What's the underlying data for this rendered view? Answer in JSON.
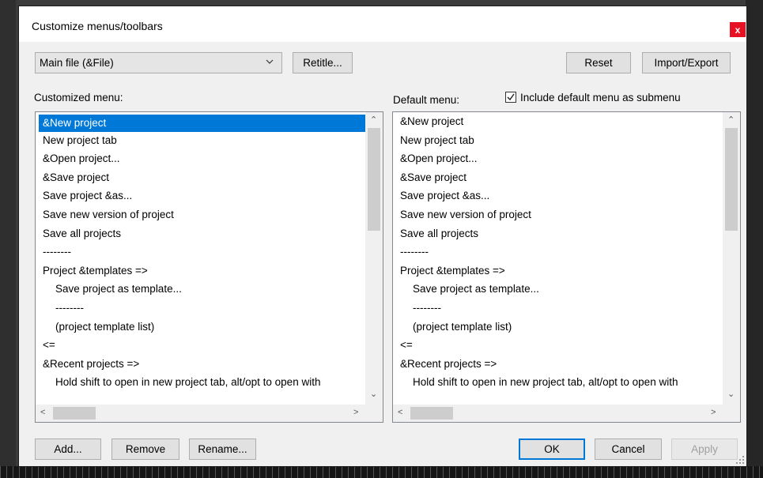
{
  "dialog": {
    "title": "Customize menus/toolbars",
    "close_label": "x"
  },
  "toolbar": {
    "menu_select_value": "Main file (&File)",
    "retitle_label": "Retitle...",
    "reset_label": "Reset",
    "import_export_label": "Import/Export"
  },
  "customized": {
    "label": "Customized menu:",
    "items": [
      "&New project",
      "New project tab",
      "&Open project...",
      "&Save project",
      "Save project &as...",
      "Save new version of project",
      "Save all projects",
      "--------",
      "Project &templates =>",
      "Save project as template...",
      "--------",
      "(project template list)",
      "<=",
      "&Recent projects =>",
      "Hold shift to open in new project tab, alt/opt to open with"
    ]
  },
  "default": {
    "label": "Default menu:",
    "include_label": "Include default menu as submenu",
    "include_checked": true,
    "items": [
      "&New project",
      "New project tab",
      "&Open project...",
      "&Save project",
      "Save project &as...",
      "Save new version of project",
      "Save all projects",
      "--------",
      "Project &templates =>",
      "Save project as template...",
      "--------",
      "(project template list)",
      "<=",
      "&Recent projects =>",
      "Hold shift to open in new project tab, alt/opt to open with"
    ]
  },
  "footer": {
    "add_label": "Add...",
    "remove_label": "Remove",
    "rename_label": "Rename...",
    "ok_label": "OK",
    "cancel_label": "Cancel",
    "apply_label": "Apply"
  },
  "colors": {
    "selection": "#0078d7",
    "close_button": "#e81123"
  }
}
